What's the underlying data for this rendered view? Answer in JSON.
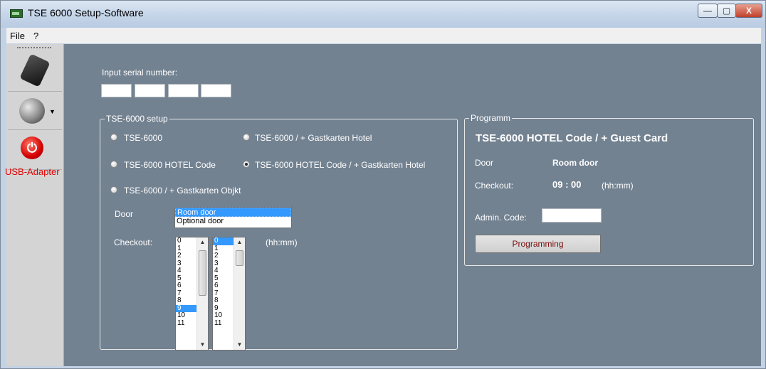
{
  "window": {
    "title": "TSE 6000 Setup-Software",
    "controls": {
      "minimize": "—",
      "maximize": "▢",
      "close": "X"
    }
  },
  "menu": {
    "file": "File",
    "help": "?"
  },
  "toolbar": {
    "usb_label": "USB-Adapter",
    "power_glyph": "⏻"
  },
  "serial": {
    "label": "Input serial number:"
  },
  "setup": {
    "legend": "TSE-6000 setup",
    "options": [
      {
        "label": "TSE-6000",
        "checked": false
      },
      {
        "label": "TSE-6000 / + Gastkarten Hotel",
        "checked": false
      },
      {
        "label": "TSE-6000 HOTEL Code",
        "checked": false
      },
      {
        "label": "TSE-6000 HOTEL Code / + Gastkarten Hotel",
        "checked": true
      },
      {
        "label": "TSE-6000 / + Gastkarten Objkt",
        "checked": false
      }
    ],
    "door_label": "Door",
    "door_options": [
      "Room door",
      "Optional door"
    ],
    "door_selected": "Room door",
    "checkout_label": "Checkout:",
    "hours": [
      "0",
      "1",
      "2",
      "3",
      "4",
      "5",
      "6",
      "7",
      "8",
      "9",
      "10",
      "11"
    ],
    "hours_selected": "9",
    "minutes": [
      "0",
      "1",
      "2",
      "3",
      "4",
      "5",
      "6",
      "7",
      "8",
      "9",
      "10",
      "11"
    ],
    "minutes_selected": "0",
    "format": "(hh:mm)"
  },
  "program": {
    "legend": "Programm",
    "heading": "TSE-6000 HOTEL Code / + Guest Card",
    "door_label": "Door",
    "door_value": "Room door",
    "checkout_label": "Checkout:",
    "checkout_value": "09 : 00",
    "format": "(hh:mm)",
    "admin_label": "Admin. Code:",
    "button_label": "Programming"
  },
  "colors": {
    "panel": "#738291",
    "selection": "#3399ff",
    "usb_label": "#e00000"
  }
}
